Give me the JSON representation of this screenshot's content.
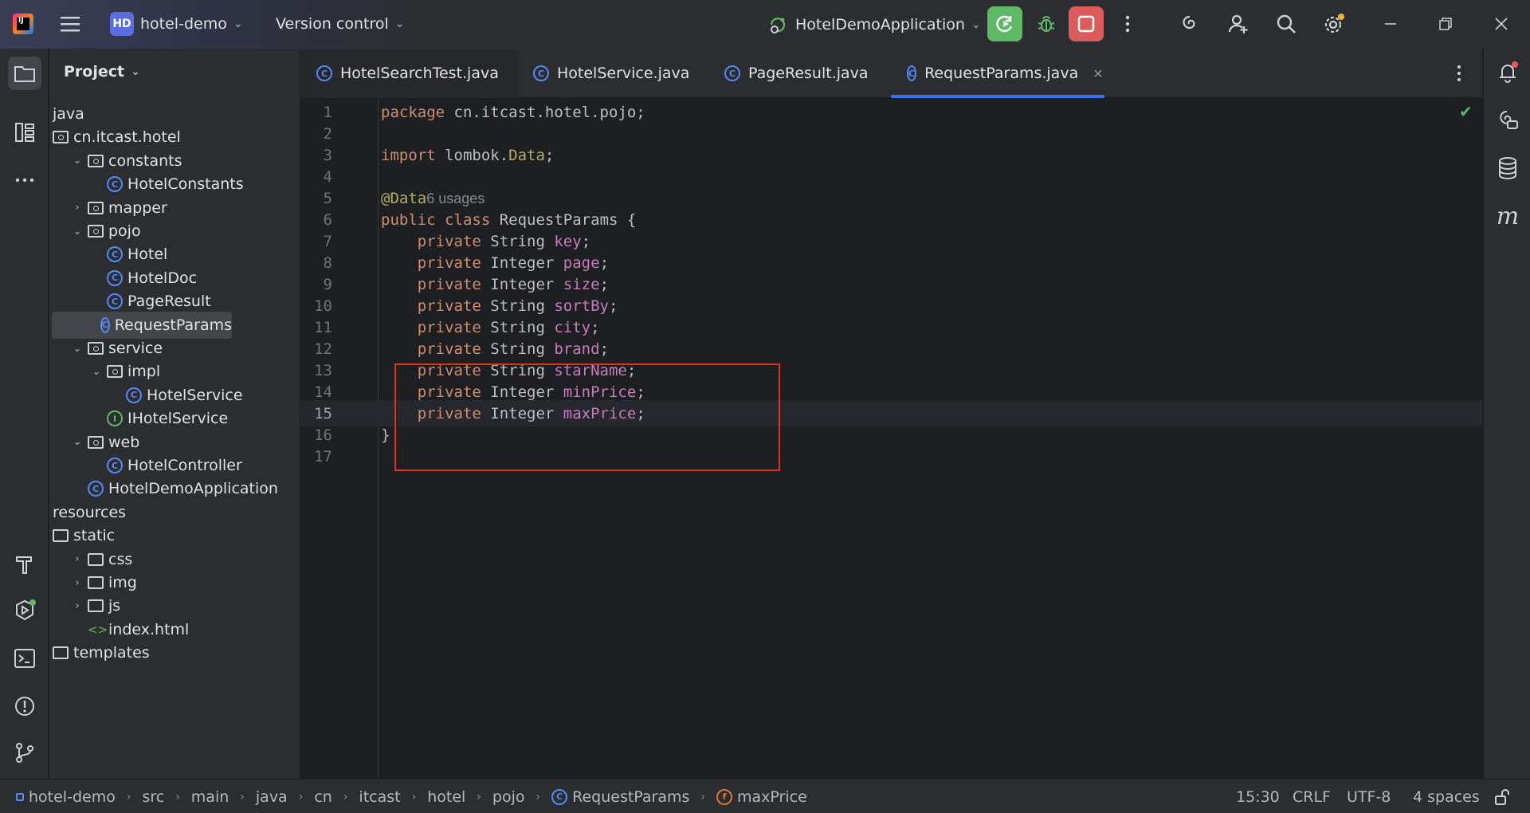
{
  "titlebar": {
    "app_logo_text": "IJ",
    "project_badge": "HD",
    "project_name": "hotel-demo",
    "vcs_menu": "Version control",
    "run_config": "HotelDemoApplication"
  },
  "project_panel": {
    "title": "Project",
    "tree": [
      {
        "label": "java",
        "icon": "none"
      },
      {
        "label": "cn.itcast.hotel",
        "icon": "package-icon"
      },
      {
        "label": "constants",
        "icon": "package-icon",
        "arrow": "expanded"
      },
      {
        "label": "HotelConstants",
        "icon": "class-icon"
      },
      {
        "label": "mapper",
        "icon": "package-icon",
        "arrow": "collapsed"
      },
      {
        "label": "pojo",
        "icon": "package-icon",
        "arrow": "expanded"
      },
      {
        "label": "Hotel",
        "icon": "class-icon"
      },
      {
        "label": "HotelDoc",
        "icon": "class-icon"
      },
      {
        "label": "PageResult",
        "icon": "class-icon"
      },
      {
        "label": "RequestParams",
        "icon": "class-icon",
        "selected": true
      },
      {
        "label": "service",
        "icon": "package-icon",
        "arrow": "expanded"
      },
      {
        "label": "impl",
        "icon": "package-icon",
        "arrow": "expanded"
      },
      {
        "label": "HotelService",
        "icon": "class-icon"
      },
      {
        "label": "IHotelService",
        "icon": "interface-icon"
      },
      {
        "label": "web",
        "icon": "package-icon",
        "arrow": "expanded"
      },
      {
        "label": "HotelController",
        "icon": "class-icon"
      },
      {
        "label": "HotelDemoApplication",
        "icon": "spring-app-icon"
      },
      {
        "label": "resources",
        "icon": "none"
      },
      {
        "label": "static",
        "icon": "folder-icon"
      },
      {
        "label": "css",
        "icon": "folder-icon",
        "arrow": "collapsed"
      },
      {
        "label": "img",
        "icon": "folder-icon",
        "arrow": "collapsed"
      },
      {
        "label": "js",
        "icon": "folder-icon",
        "arrow": "collapsed"
      },
      {
        "label": "index.html",
        "icon": "html-icon"
      },
      {
        "label": "templates",
        "icon": "folder-icon"
      }
    ]
  },
  "tabs": [
    {
      "label": "HotelSearchTest.java"
    },
    {
      "label": "HotelService.java"
    },
    {
      "label": "PageResult.java"
    },
    {
      "label": "RequestParams.java",
      "active": true
    }
  ],
  "editor": {
    "lines": [
      {
        "n": "1",
        "text": "package cn.itcast.hotel.pojo;"
      },
      {
        "n": "2",
        "text": ""
      },
      {
        "n": "3",
        "text": "import lombok.Data;"
      },
      {
        "n": "4",
        "text": ""
      },
      {
        "n": "5",
        "text": "@Data",
        "usages": "6 usages"
      },
      {
        "n": "6",
        "text": "public class RequestParams {"
      },
      {
        "n": "7",
        "text": "    private String key;"
      },
      {
        "n": "8",
        "text": "    private Integer page;"
      },
      {
        "n": "9",
        "text": "    private Integer size;"
      },
      {
        "n": "10",
        "text": "    private String sortBy;"
      },
      {
        "n": "11",
        "text": "    private String city;"
      },
      {
        "n": "12",
        "text": "    private String brand;"
      },
      {
        "n": "13",
        "text": "    private String starName;"
      },
      {
        "n": "14",
        "text": "    private Integer minPrice;"
      },
      {
        "n": "15",
        "text": "    private Integer maxPrice;"
      },
      {
        "n": "16",
        "text": "}"
      },
      {
        "n": "17",
        "text": ""
      }
    ],
    "current_line": 15
  },
  "statusbar": {
    "breadcrumbs": [
      "hotel-demo",
      "src",
      "main",
      "java",
      "cn",
      "itcast",
      "hotel",
      "pojo",
      "RequestParams",
      "maxPrice"
    ],
    "position": "15:30",
    "line_sep": "CRLF",
    "encoding": "UTF-8",
    "indent": "4 spaces"
  },
  "colors": {
    "accent": "#3574f0",
    "run_green": "#5fb865",
    "stop_red": "#db5c5c",
    "highlight_box": "#e0301e"
  }
}
